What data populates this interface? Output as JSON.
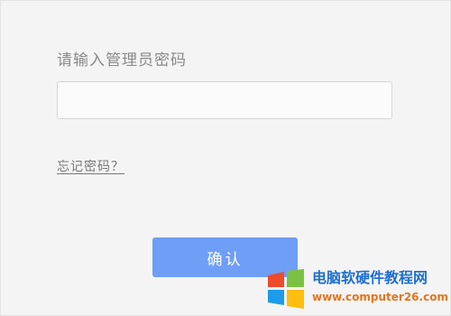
{
  "login": {
    "prompt": "请输入管理员密码",
    "password_value": "",
    "password_placeholder": "",
    "forgot_password": "忘记密码？",
    "confirm_label": "确认"
  },
  "watermark": {
    "title": "电脑软硬件教程网",
    "url": "www.computer26.com",
    "logo_icon": "windows-logo-icon"
  },
  "colors": {
    "background": "#f4f4f4",
    "button": "#6f9ef7",
    "label_text": "#8a8a8a",
    "watermark_title": "#1f6fcf",
    "watermark_url": "#e2751f"
  }
}
